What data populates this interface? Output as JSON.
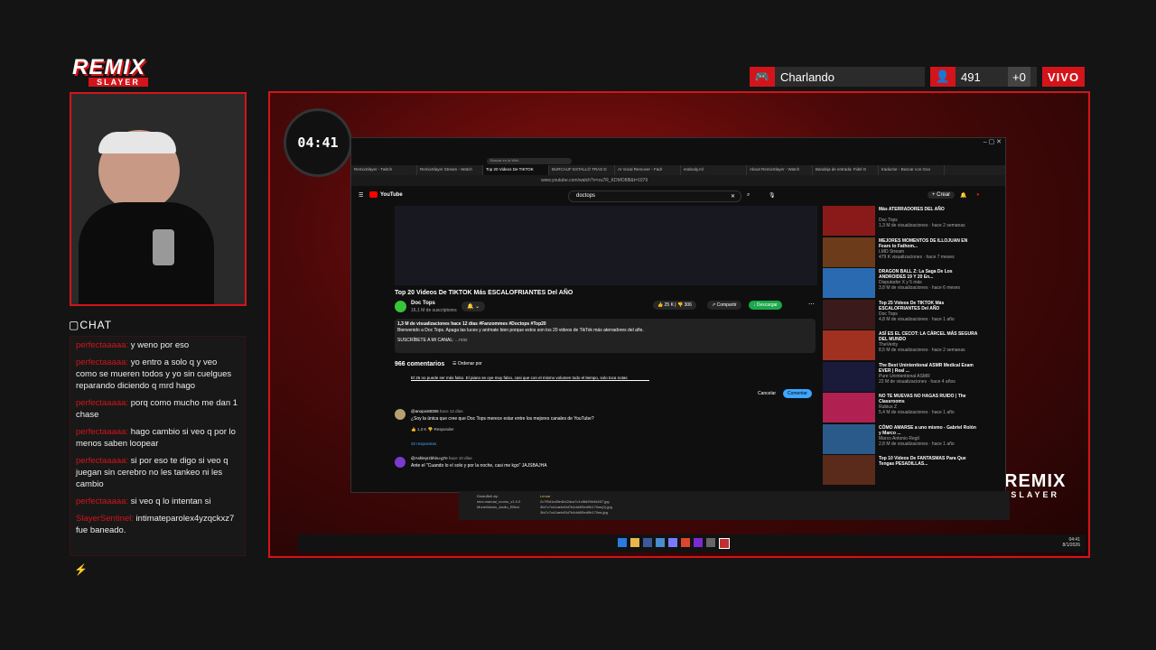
{
  "overlay": {
    "logo_top": "REMIX",
    "logo_bottom": "SLAYER",
    "activity": "Charlando",
    "viewers": "491",
    "viewers_delta": "+0",
    "live": "VIVO",
    "timer": "04:41",
    "chat_title": "CHAT",
    "chat": [
      {
        "user": "perfectaaaaa:",
        "text": "y weno por eso"
      },
      {
        "user": "perfectaaaaa:",
        "text": "yo entro a solo q y veo como se mueren todos y yo sin cuelgues reparando diciendo q mrd hago"
      },
      {
        "user": "perfectaaaaa:",
        "text": "porq como mucho me dan 1 chase"
      },
      {
        "user": "perfectaaaaa:",
        "text": "hago cambio si veo q por lo menos saben loopear"
      },
      {
        "user": "perfectaaaaa:",
        "text": "si por eso te digo si veo q juegan sin cerebro no les tankeo ni les cambio"
      },
      {
        "user": "perfectaaaaa:",
        "text": "si veo q lo intentan si"
      },
      {
        "user": "SlayerSentinel:",
        "text": "intimateparolex4yzqckxz7 fue baneado."
      }
    ],
    "brand_right_top": "REMIX",
    "brand_right_bottom": "SLAYER"
  },
  "browser": {
    "tabs": [
      "RemixSlayer - Twitch",
      "RemixSlayer Stream - Watch",
      "Top 20 Videos De TIKTOK",
      "BURCAUF ESTALLÓ TRAS D",
      "AI Vocal Remover - Fadr",
      "erabody.ml",
      "About RemixSlayer - Watch",
      "Bandeja de entrada: Fidel G",
      "traductor - Buscar con Goo"
    ],
    "url": "www.youtube.com/watch?v=zu7R_KDMO88l&t=1079",
    "search_placeholder": "Buscar en la Web",
    "youtube_label": "YouTube",
    "search_query": "doctops",
    "create": "Crear",
    "video_title": "Top 20 Videos De TIKTOK Más ESCALOFRIANTES Del AÑO",
    "channel": "Doc Tops",
    "subs": "16,1 M de suscriptores",
    "likes": "25 K",
    "dislikes": "306",
    "share": "Compartir",
    "download": "Descargar",
    "views_line": "1,3 M de visualizaciones  hace 12 días  #Fanzommes #Doctops #Top20",
    "description": "Bienvenido a Doc Tops.  Apaga las luces y anímate bien porque estos son los 20 videos de TikTok más aterradores del año.",
    "subscribe_line": "SUSCRÍBETE A MI CANAL:",
    "more": "...más",
    "comments_count": "966 comentarios",
    "sort": "Ordenar por",
    "draft_comment": "El 26 no puede ser más falso. El piano se oye muy falso, casi que con el mismo volumen todo el tiempo, solo toca notas",
    "cancel": "Cancelar",
    "comment_btn": "Comentar",
    "comments": [
      {
        "author": "@anopost8306",
        "time": "hace 12 días",
        "text": "¿Soy la única que cree que Doc Tops merece estar entre los mejores canales de YouTube?",
        "likes": "1,3 K",
        "reply": "Responder",
        "replies": "32 respuestas"
      },
      {
        "author": "@AshleyIzbhiru-g7e",
        "time": "hace 10 días",
        "text": "Ante el \"Cuando lo ví solo y por la noche, casi me kgo\" JAJSBAJHA"
      }
    ],
    "sidebar": [
      {
        "title": "Más ATERRADORES DEL AÑO",
        "channel": "Doc Tops",
        "meta": "1,3 M de visualizaciones · hace 2 semanas",
        "color": "#8a1a1a"
      },
      {
        "title": "MEJORES MOMENTOS DE ILLOJUAN EN Fears to Fathom...",
        "channel": "LMD Stream",
        "meta": "479 K visualizaciones · hace 7 meses",
        "color": "#6b3b1a"
      },
      {
        "title": "DRAGON BALL Z: La Saga De Los ANDROIDES 19 Y 20 En...",
        "channel": "Disputador X y 5 más",
        "meta": "3,8 M de visualizaciones · hace 6 meses",
        "color": "#2a6ab0"
      },
      {
        "title": "Top 25 Videos De TIKTOK Más ESCALOFRIANTES Del AÑO",
        "channel": "Doc Tops",
        "meta": "4,8 M de visualizaciones · hace 1 año",
        "color": "#3a1a1a"
      },
      {
        "title": "ASÍ ES EL CECOT: LA CÁRCEL MÁS SEGURA DEL MUNDO",
        "channel": "TheVerity",
        "meta": "8,5 M de visualizaciones · hace 2 semanas",
        "color": "#a03020"
      },
      {
        "title": "The Best Unintentional ASMR Medical Exam EVER | Real ...",
        "channel": "Pure Unintentional ASMR",
        "meta": "22 M de visualizaciones · hace 4 años",
        "color": "#1a1a3a"
      },
      {
        "title": "NO TE MUEVAS NO HAGAS RUIDO | The Classrooms",
        "channel": "Rubius Z",
        "meta": "5,4 M de visualizaciones · hace 1 año",
        "color": "#b02050"
      },
      {
        "title": "CÓMO AMARSE a uno mismo - Gabriel Rolón y Marco ...",
        "channel": "Marco Antonio Regil",
        "meta": "2,8 M de visualizaciones · hace 1 año",
        "color": "#2a5a8a"
      },
      {
        "title": "Top 10 Videos De FANTASMAS Para Que Tengas PESADILLAS...",
        "channel": "",
        "meta": "",
        "color": "#5a2a1a"
      }
    ]
  },
  "explorer": {
    "files": [
      "DioduBell.zip",
      "miui-manual_rcomu_v1.0.0",
      "MuneWaves_Audio_Effect"
    ],
    "files_right": [
      "Lemar",
      "2c7f9d1cd5e4b42dca7c1cf8d99b3d457.jpg",
      "3fa7c7cd1aeb45d7b4dd4f5ed9b170ea(1).jpg",
      "3fa7c7cd1aeb45d7b4dd4f5ed9b170ea.jpg"
    ]
  },
  "taskbar": {
    "time": "04:41",
    "date": "8/1/2026"
  },
  "colors": {
    "accent": "#d3141b"
  }
}
